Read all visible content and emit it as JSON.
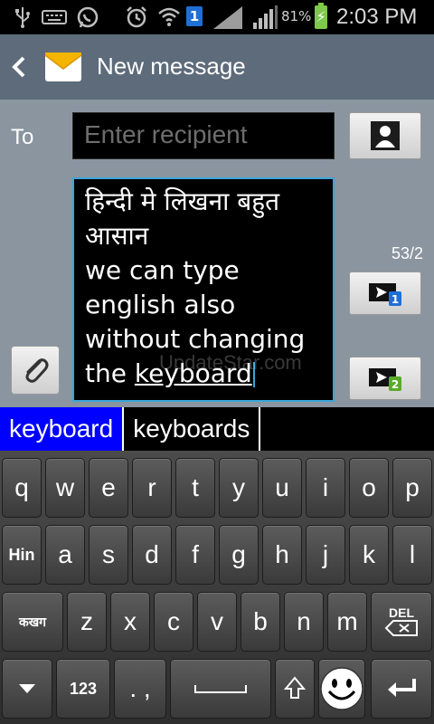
{
  "status_bar": {
    "badge_number": "1",
    "battery_percent": "81%",
    "time": "2:03 PM"
  },
  "header": {
    "title": "New message"
  },
  "compose": {
    "to_label": "To",
    "recipient_placeholder": "Enter recipient",
    "char_counter": "53/2",
    "send_sim1_badge": "1",
    "send_sim2_badge": "2",
    "message_lines": [
      "हिन्दी मे लिखना बहुत",
      "आसान",
      "we can type",
      "english also",
      "without changing"
    ],
    "message_last_prefix": "the ",
    "message_last_word": "keyboard",
    "watermark": "UpdateStar.com"
  },
  "suggestions": [
    "keyboard",
    "keyboards"
  ],
  "keyboard": {
    "row1": [
      "q",
      "w",
      "e",
      "r",
      "t",
      "y",
      "u",
      "i",
      "o",
      "p"
    ],
    "row2_lang": "Hin",
    "row2": [
      "a",
      "s",
      "d",
      "f",
      "g",
      "h",
      "j",
      "k",
      "l"
    ],
    "row3_lang": "कखग",
    "row3": [
      "z",
      "x",
      "c",
      "v",
      "b",
      "n",
      "m"
    ],
    "delete_label": "DEL",
    "numbers_label": "123",
    "punct_label": ". ,"
  },
  "colors": {
    "header_bg": "#5d6b7a",
    "compose_bg": "#8a95a0",
    "focus_border": "#3aa6d8",
    "suggestion_active": "#0000ff",
    "battery": "#7ec94a",
    "sim1_badge": "#1e6fd6",
    "sim2_badge": "#5aaa2a"
  }
}
